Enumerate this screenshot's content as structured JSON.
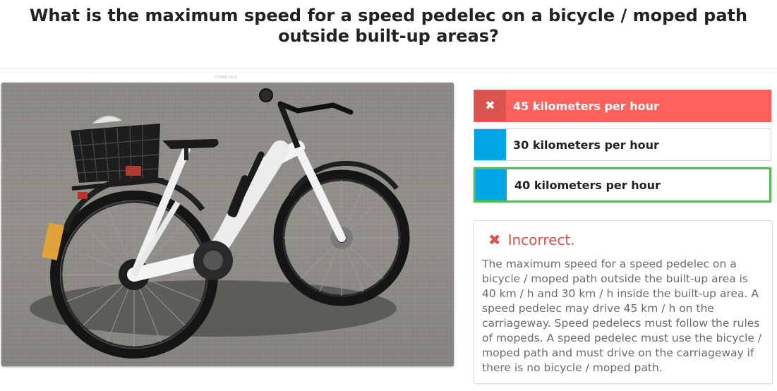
{
  "question": {
    "title": "What is the maximum speed for a speed pedelec on a bicycle / moped path outside built-up areas?"
  },
  "image": {
    "credit": "STRAIB DATA",
    "subject": "white speed pedelec e-bike with black basket"
  },
  "answers": [
    {
      "text": "45 kilometers per hour",
      "state": "selected-incorrect",
      "icon": "close-icon"
    },
    {
      "text": "30 kilometers per hour",
      "state": "neutral"
    },
    {
      "text": "40 kilometers per hour",
      "state": "correct"
    }
  ],
  "feedback": {
    "icon": "close-icon",
    "title": "Incorrect.",
    "body": "The maximum speed for a speed pedelec on a bicycle / moped path outside the built-up area is 40 km / h and 30 km / h inside the built-up area. A speed pedelec may drive 45 km / h on the carriageway. Speed pedelecs must follow the rules of mopeds. A speed pedelec must use the bicycle / moped path and must drive on the carriageway if there is no bicycle / moped path."
  },
  "colors": {
    "incorrect": "#ff625c",
    "incorrect_dark": "#d9534f",
    "correct_border": "#5cb85c",
    "answer_marker": "#00a6e6"
  }
}
